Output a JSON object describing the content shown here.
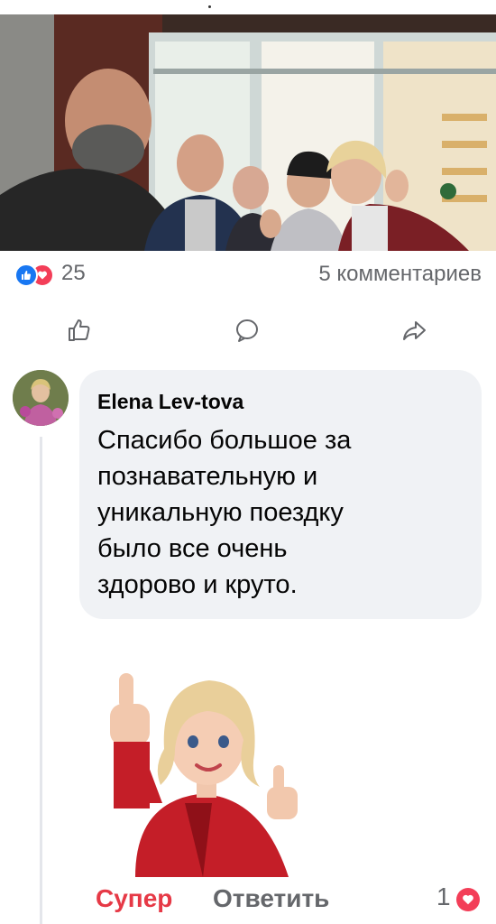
{
  "post": {
    "photo_alt": "group-selfie",
    "reaction_count": "25",
    "comments_label": "5 комментариев"
  },
  "comment": {
    "author": "Elena Lev-tova",
    "lines": [
      "Спасибо большое  за",
      "познавательную и",
      "уникальную поездку",
      "было все очень",
      "здорово и круто."
    ],
    "reaction_label": "Супер",
    "reply_label": "Ответить",
    "like_count": "1"
  },
  "colors": {
    "like_blue": "#1877f2",
    "love_red": "#f33e58",
    "super_red": "#e63946",
    "bubble_bg": "#f0f2f5",
    "secondary_text": "#65676b"
  },
  "icons": [
    "like-icon",
    "love-icon",
    "thumbs-up-icon",
    "comment-icon",
    "share-icon",
    "heart-icon"
  ]
}
